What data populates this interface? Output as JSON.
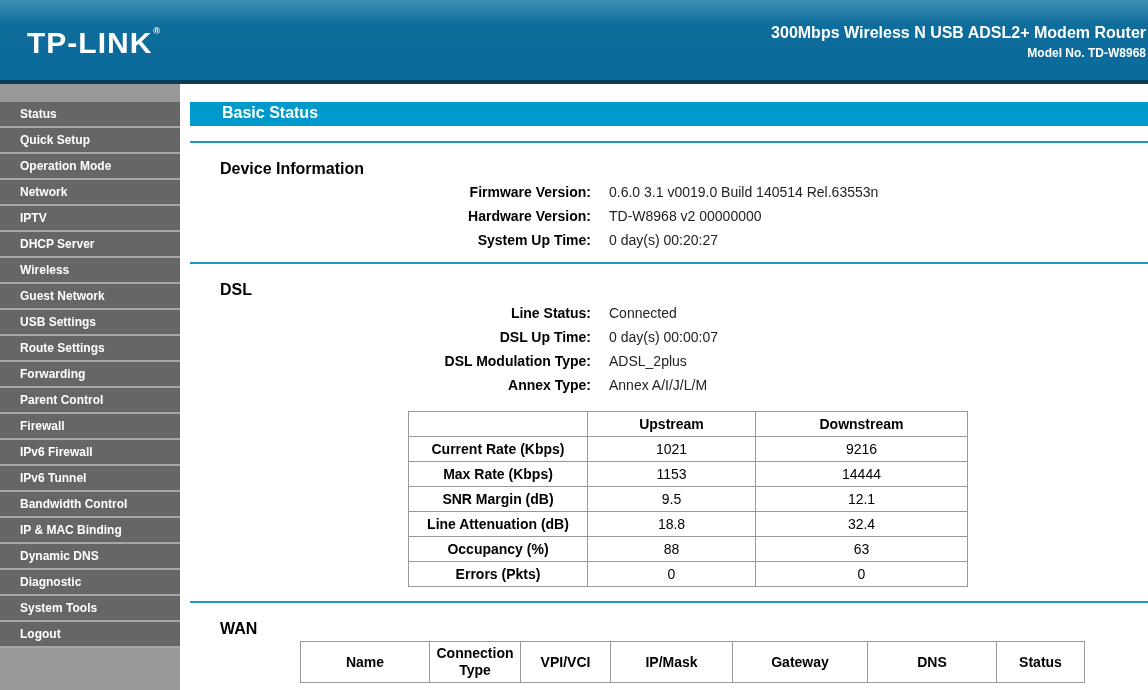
{
  "header": {
    "logo": "TP-LINK",
    "logo_mark": "®",
    "product": "300Mbps Wireless N USB ADSL2+ Modem Router",
    "model": "Model No. TD-W8968"
  },
  "sidebar": {
    "items": [
      {
        "label": "Status"
      },
      {
        "label": "Quick Setup"
      },
      {
        "label": "Operation Mode"
      },
      {
        "label": "Network"
      },
      {
        "label": "IPTV"
      },
      {
        "label": "DHCP Server"
      },
      {
        "label": "Wireless"
      },
      {
        "label": "Guest Network"
      },
      {
        "label": "USB Settings"
      },
      {
        "label": "Route Settings"
      },
      {
        "label": "Forwarding"
      },
      {
        "label": "Parent Control"
      },
      {
        "label": "Firewall"
      },
      {
        "label": "IPv6 Firewall"
      },
      {
        "label": "IPv6 Tunnel"
      },
      {
        "label": "Bandwidth Control"
      },
      {
        "label": "IP & MAC Binding"
      },
      {
        "label": "Dynamic DNS"
      },
      {
        "label": "Diagnostic"
      },
      {
        "label": "System Tools"
      },
      {
        "label": "Logout"
      }
    ]
  },
  "page_title": "Basic Status",
  "sections": [
    {
      "title": "Device Information",
      "fields": [
        {
          "label": "Firmware Version:",
          "value": "0.6.0 3.1 v0019.0 Build 140514 Rel.63553n"
        },
        {
          "label": "Hardware Version:",
          "value": "TD-W8968 v2 00000000"
        },
        {
          "label": "System Up Time:",
          "value": "0 day(s) 00:20:27"
        }
      ]
    },
    {
      "title": "DSL",
      "fields": [
        {
          "label": "Line Status:",
          "value": "Connected"
        },
        {
          "label": "DSL Up Time:",
          "value": "0 day(s) 00:00:07"
        },
        {
          "label": "DSL Modulation Type:",
          "value": "ADSL_2plus"
        },
        {
          "label": "Annex Type:",
          "value": "Annex A/I/J/L/M"
        }
      ],
      "table": {
        "columns": [
          "",
          "Upstream",
          "Downstream"
        ],
        "rows": [
          [
            "Current Rate (Kbps)",
            "1021",
            "9216"
          ],
          [
            "Max Rate (Kbps)",
            "1153",
            "14444"
          ],
          [
            "SNR Margin (dB)",
            "9.5",
            "12.1"
          ],
          [
            "Line Attenuation (dB)",
            "18.8",
            "32.4"
          ],
          [
            "Occupancy (%)",
            "88",
            "63"
          ],
          [
            "Errors (Pkts)",
            "0",
            "0"
          ]
        ]
      }
    },
    {
      "title": "WAN",
      "table": {
        "kind": "header_only",
        "columns": [
          "Name",
          "Connection Type",
          "VPI/VCI",
          "IP/Mask",
          "Gateway",
          "DNS",
          "Status"
        ]
      }
    }
  ]
}
